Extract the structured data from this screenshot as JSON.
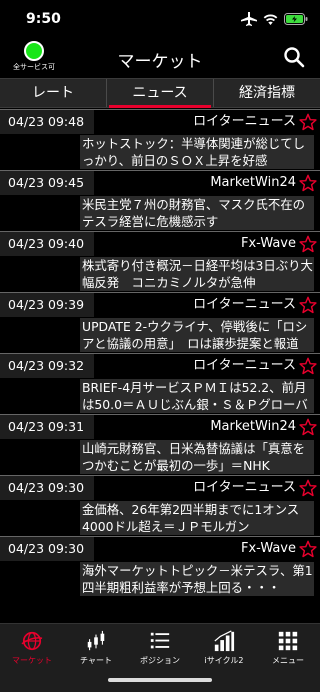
{
  "status_bar": {
    "time": "9:50"
  },
  "header": {
    "title": "マーケット",
    "service_status": "全サービス可"
  },
  "tabs": [
    {
      "label": "レート",
      "active": false
    },
    {
      "label": "ニュース",
      "active": true
    },
    {
      "label": "経済指標",
      "active": false
    }
  ],
  "news": [
    {
      "date": "04/23 09:48",
      "source": "ロイターニュース",
      "headline": "ホットストック：半導体関連が総じてしっかり、前日のＳＯＸ上昇を好感"
    },
    {
      "date": "04/23 09:45",
      "source": "MarketWin24",
      "headline": "米民主党７州の財務官、マスク氏不在のテスラ経営に危機感示す"
    },
    {
      "date": "04/23 09:40",
      "source": "Fx-Wave",
      "headline": "株式寄り付き概況－日経平均は3日ぶり大幅反発　コニカミノルタが急伸"
    },
    {
      "date": "04/23 09:39",
      "source": "ロイターニュース",
      "headline": "UPDATE 2-ウクライナ、停戦後に「ロシアと協議の用意」　ロは譲歩提案と報道"
    },
    {
      "date": "04/23 09:32",
      "source": "ロイターニュース",
      "headline": "BRIEF-4月サービスＰＭＩは52.2、前月は50.0＝ＡＵじぶん銀・Ｓ＆Ｐグローバル"
    },
    {
      "date": "04/23 09:31",
      "source": "MarketWin24",
      "headline": "山崎元財務官、日米為替協議は「真意をつかむことが最初の一歩」＝NHK"
    },
    {
      "date": "04/23 09:30",
      "source": "ロイターニュース",
      "headline": "金価格、26年第2四半期までに1オンス4000ドル超え＝ＪＰモルガン"
    },
    {
      "date": "04/23 09:30",
      "source": "Fx-Wave",
      "headline": "海外マーケットトピック－米テスラ、第1四半期粗利益率が予想上回る・・・"
    }
  ],
  "bottom_tabs": [
    {
      "label": "マーケット",
      "icon": "globe-icon",
      "active": true
    },
    {
      "label": "チャート",
      "icon": "candlestick-icon",
      "active": false
    },
    {
      "label": "ポジション",
      "icon": "list-icon",
      "active": false
    },
    {
      "label": "iサイクル2",
      "icon": "bar-chart-icon",
      "active": false
    },
    {
      "label": "メニュー",
      "icon": "grid-icon",
      "active": false
    }
  ],
  "colors": {
    "accent": "#e8002d",
    "status_ok": "#19e619",
    "background": "#000000",
    "tab_bar": "#262626"
  }
}
